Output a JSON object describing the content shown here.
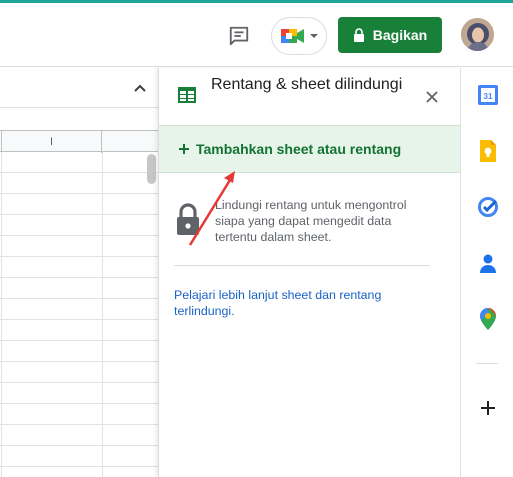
{
  "header": {
    "share_label": "Bagikan",
    "comment_icon": "comment-icon",
    "meet_icon": "google-meet-icon",
    "share_icon": "lock-icon"
  },
  "sheet": {
    "column_letter": "I",
    "collapse_icon": "chevron-up-icon"
  },
  "panel": {
    "title": "Rentang & sheet dilindungi",
    "add_label": "Tambahkan sheet atau rentang",
    "info_text": "Lindungi rentang untuk mengontrol siapa yang dapat mengedit data tertentu dalam sheet.",
    "learn_more": "Pelajari lebih lanjut sheet dan rentang terlindungi."
  },
  "side_panel": {
    "items": [
      "calendar-icon",
      "keep-icon",
      "tasks-icon",
      "contacts-icon",
      "maps-icon"
    ],
    "calendar_day": "31",
    "add_icon": "plus-icon"
  },
  "colors": {
    "primary_green": "#188038",
    "add_row_bg": "#e6f4ea",
    "link_blue": "#1a62c8",
    "annotation_red": "#e53935",
    "accent_teal": "#1fa69b"
  }
}
